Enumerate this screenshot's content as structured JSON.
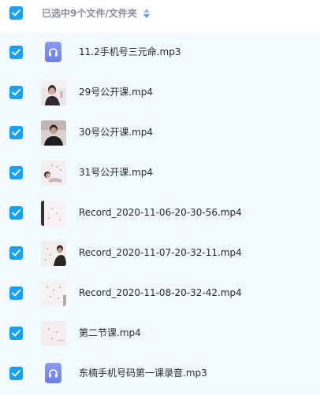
{
  "header": {
    "selection_text": "已选中9个文件/文件夹",
    "sort_icon": "sort-updown-icon",
    "checked": true
  },
  "colors": {
    "accent": "#1aa1f5",
    "list_bg": "#f2f9ff",
    "header_text": "#878c9c",
    "file_text": "#252a35",
    "audio_icon": "#7b87f4"
  },
  "files": [
    {
      "name": "11.2手机号三元命.mp3",
      "type": "audio",
      "icon": "headphones-icon",
      "checked": true
    },
    {
      "name": "29号公开课.mp4",
      "type": "video",
      "icon": "video-thumbnail",
      "checked": true
    },
    {
      "name": "30号公开课.mp4",
      "type": "video",
      "icon": "video-thumbnail",
      "checked": true
    },
    {
      "name": "31号公开课.mp4",
      "type": "video",
      "icon": "video-thumbnail",
      "checked": true
    },
    {
      "name": "Record_2020-11-06-20-30-56.mp4",
      "type": "video",
      "icon": "video-thumbnail",
      "checked": true
    },
    {
      "name": "Record_2020-11-07-20-32-11.mp4",
      "type": "video",
      "icon": "video-thumbnail",
      "checked": true
    },
    {
      "name": "Record_2020-11-08-20-32-42.mp4",
      "type": "video",
      "icon": "video-thumbnail",
      "checked": true
    },
    {
      "name": "第二节课.mp4",
      "type": "video",
      "icon": "video-thumbnail",
      "checked": true
    },
    {
      "name": "东楠手机号码第一课录音.mp3",
      "type": "audio",
      "icon": "headphones-icon",
      "checked": true
    }
  ]
}
